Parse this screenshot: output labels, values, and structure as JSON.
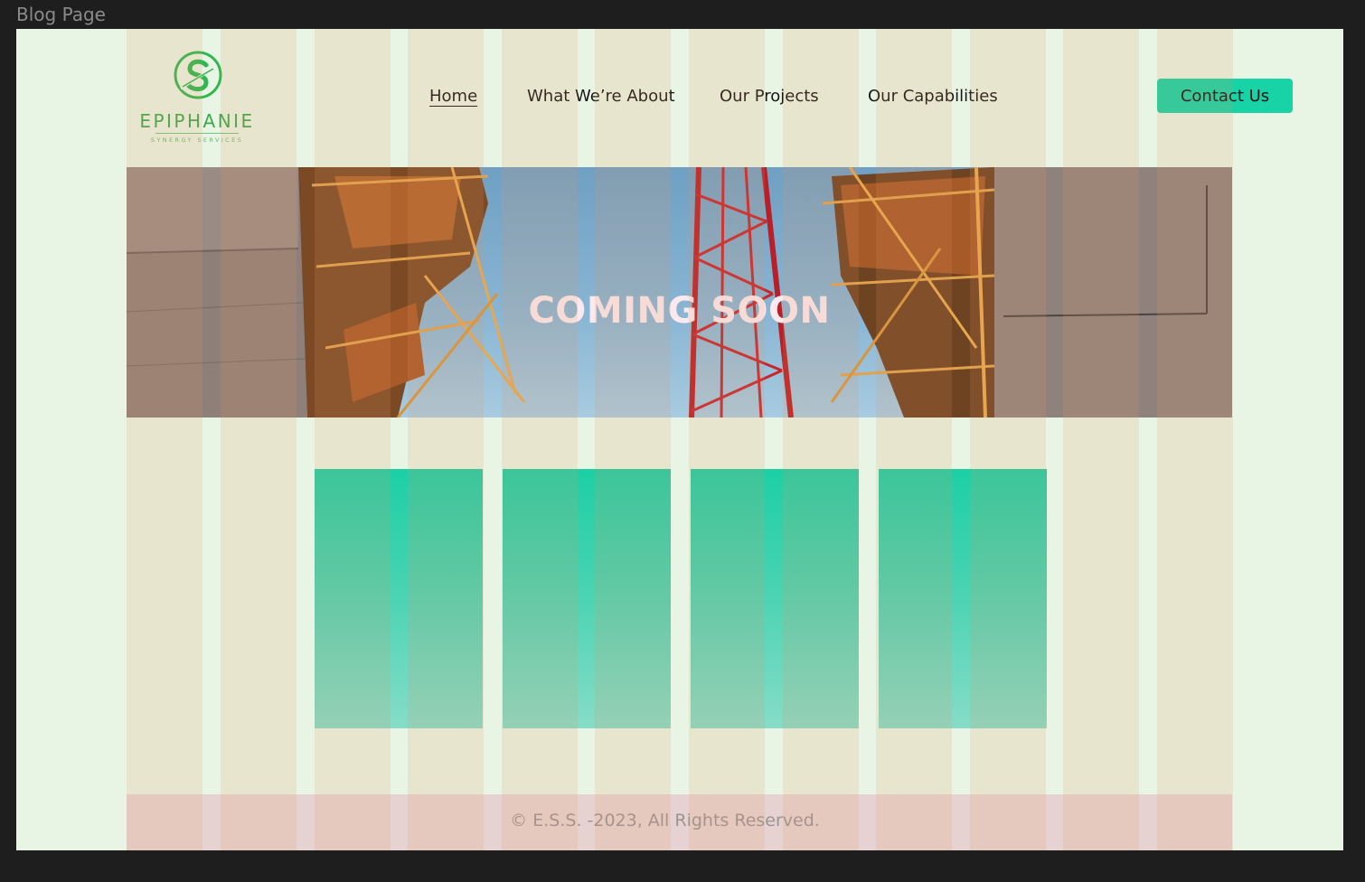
{
  "frame": {
    "label": "Blog Page"
  },
  "logo": {
    "name": "EPIPHANIE",
    "tagline": "SYNERGY SERVICES",
    "mark_letter": "S"
  },
  "nav": {
    "items": [
      {
        "label": "Home",
        "active": true
      },
      {
        "label": "What We’re About",
        "active": false
      },
      {
        "label": "Our Projects",
        "active": false
      },
      {
        "label": "Our Capabilities",
        "active": false
      }
    ],
    "contact_label": "Contact Us"
  },
  "hero": {
    "title": "COMING SOON"
  },
  "cards": {
    "count": 4
  },
  "footer": {
    "text": "© E.S.S. -2023, All Rights Reserved."
  },
  "colors": {
    "accent": "#17d3a6",
    "brand_green": "#3aa94a",
    "frame_bg": "#e9f5e4",
    "canvas_bg": "#1e1e1e",
    "grid_overlay": "#e898604d",
    "footer_bg": "#e08caa"
  }
}
